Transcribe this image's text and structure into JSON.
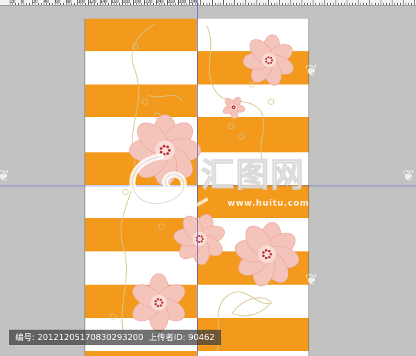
{
  "ruler": {
    "labels": [
      "20",
      "0",
      "20",
      "40",
      "60",
      "80",
      "100",
      "120",
      "140",
      "160",
      "180",
      "200",
      "220",
      "240",
      "260",
      "280",
      "300"
    ]
  },
  "artwork": {
    "stripe_color": "#f39a1d",
    "base_color": "#ffffff",
    "flower_color": "#f4c3b9",
    "flower_center_color": "#b8323c",
    "vine_color": "#d6c78a"
  },
  "guides": {
    "color": "#5860c8"
  },
  "watermark": {
    "logo_text": "汇图网",
    "url": "www.huitu.com",
    "side_glyph": "❦"
  },
  "info": {
    "id_label": "编号:",
    "id_value": "20121205170830293200",
    "uploader_label": "上传者ID:",
    "uploader_value": "90462"
  }
}
